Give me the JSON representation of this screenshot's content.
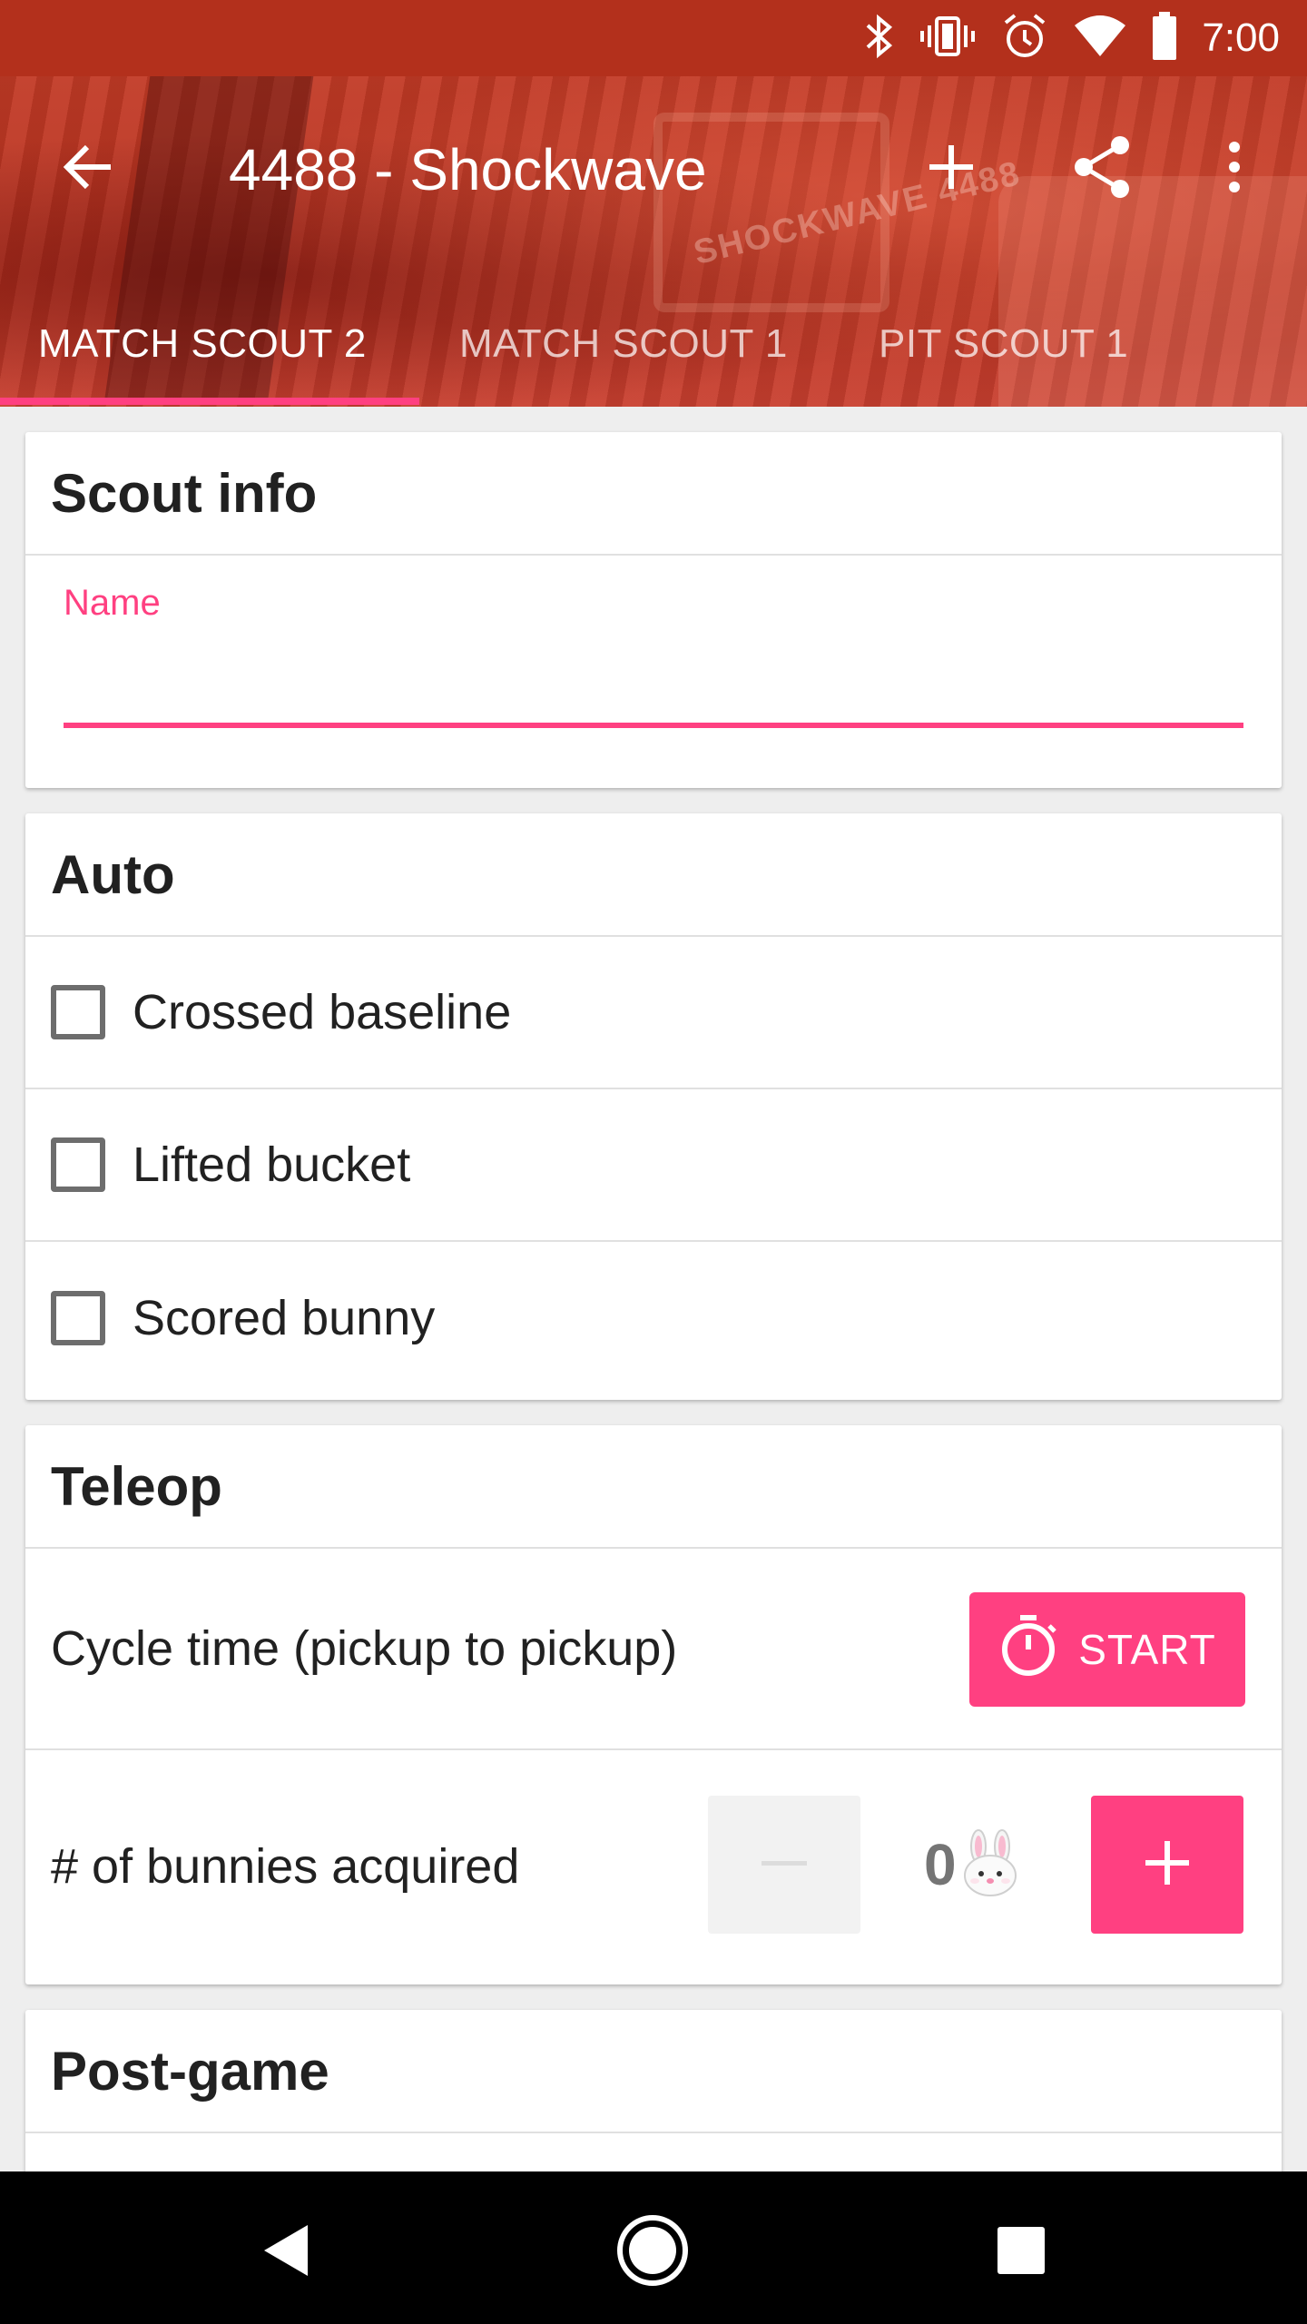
{
  "status_bar": {
    "time": "7:00",
    "icons": [
      "bluetooth-icon",
      "vibrate-icon",
      "alarm-icon",
      "wifi-icon",
      "battery-icon"
    ],
    "background": "#b3301c"
  },
  "app_bar": {
    "title": "4488 - Shockwave",
    "hero_text": "SHOCKWAVE 4488",
    "actions": [
      "back-arrow-icon",
      "add-icon",
      "share-icon",
      "more-vert-icon"
    ]
  },
  "tabs": [
    {
      "label": "MATCH SCOUT 2",
      "active": true
    },
    {
      "label": "MATCH SCOUT 1",
      "active": false
    },
    {
      "label": "PIT SCOUT 1",
      "active": false
    }
  ],
  "sections": {
    "scout_info": {
      "title": "Scout info",
      "name_label": "Name",
      "name_value": ""
    },
    "auto": {
      "title": "Auto",
      "items": [
        {
          "label": "Crossed baseline",
          "checked": false
        },
        {
          "label": "Lifted bucket",
          "checked": false
        },
        {
          "label": "Scored bunny",
          "checked": false
        }
      ]
    },
    "teleop": {
      "title": "Teleop",
      "cycle_label": "Cycle time (pickup to pickup)",
      "start_label": "START",
      "counter_label": "# of bunnies acquired",
      "counter_value": "0",
      "counter_emoji": "🐰"
    },
    "post_game": {
      "title": "Post-game"
    }
  },
  "colors": {
    "accent": "#ff4081",
    "primary_dark": "#b3301c"
  }
}
